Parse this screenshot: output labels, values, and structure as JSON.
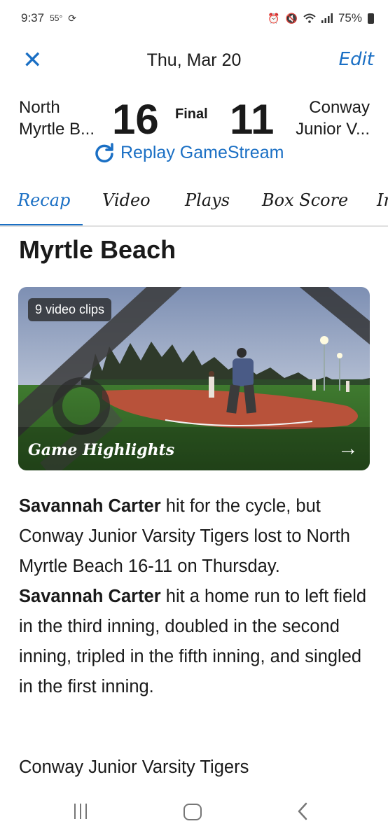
{
  "status_bar": {
    "time": "9:37",
    "temperature": "55°",
    "battery": "75%",
    "icons": [
      "sync-icon",
      "alarm-icon",
      "mute-icon",
      "wifi-icon",
      "signal-icon",
      "battery-icon"
    ]
  },
  "header": {
    "close_icon": "close-icon",
    "title": "Thu, Mar 20",
    "edit_label": "Edit"
  },
  "scoreboard": {
    "home_team_line1": "North",
    "home_team_line2": "Myrtle B...",
    "home_score": "16",
    "status": "Final",
    "away_score": "11",
    "away_team_line1": "Conway",
    "away_team_line2": "Junior V...",
    "replay_label": "Replay GameStream"
  },
  "tabs": [
    {
      "label": "Recap",
      "active": true
    },
    {
      "label": "Video",
      "active": false
    },
    {
      "label": "Plays",
      "active": false
    },
    {
      "label": "Box Score",
      "active": false
    },
    {
      "label": "In",
      "active": false
    }
  ],
  "content": {
    "section_title": "Myrtle Beach",
    "video": {
      "clips_label": "9 video clips",
      "title": "Game Highlights"
    },
    "recap": {
      "player_name": "Savannah Carter",
      "part1": " hit for the cycle, but Conway Junior Varsity Tigers lost to North Myrtle Beach 16-11 on Thursday. ",
      "part2": " hit a home run to left field in the third inning, doubled in the second inning, tripled in the fifth inning, and singled in the first inning."
    },
    "footer_text": "Conway Junior Varsity Tigers"
  },
  "colors": {
    "accent": "#1a6fc4",
    "text": "#1a1a1a"
  }
}
